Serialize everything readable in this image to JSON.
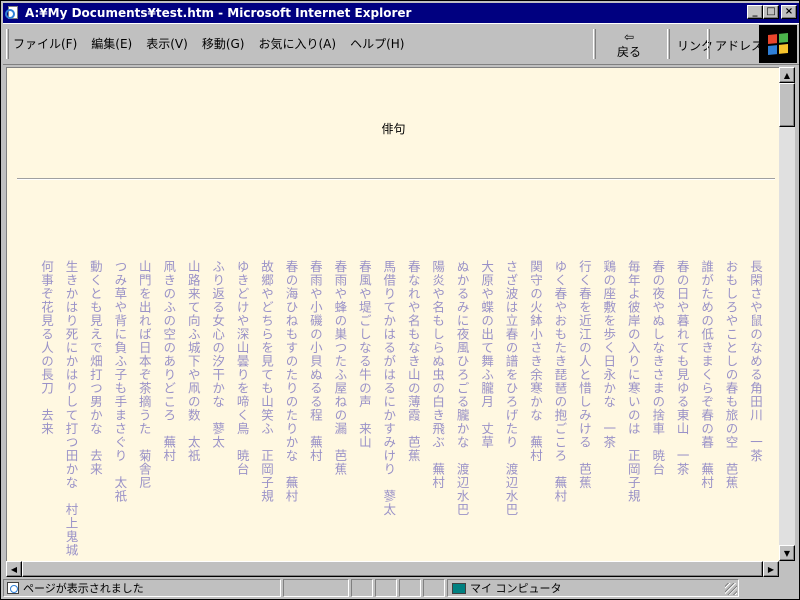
{
  "window": {
    "title": "A:¥My Documents¥test.htm - Microsoft Internet Explorer",
    "minimize_glyph": "_",
    "maximize_glyph": "□",
    "close_glyph": "×"
  },
  "menubar": {
    "items": [
      "ファイル(F)",
      "編集(E)",
      "表示(V)",
      "移動(G)",
      "お気に入り(A)",
      "ヘルプ(H)"
    ]
  },
  "toolbar": {
    "back_arrow": "⇦",
    "back_label": "戻る",
    "links_label": "リンク",
    "address_label": "アドレス"
  },
  "page": {
    "heading": "俳句",
    "haiku": [
      "長閑さや鼠のなめる角田川　一茶",
      "おもしろやことしの春も旅の空　芭蕉",
      "誰がための低きまくらぞ春の暮　蕪村",
      "春の日や暮れても見ゆる東山　一茶",
      "春の夜やぬしなきさまの捨車　暁台",
      "毎年よ彼岸の入りに寒いのは　正岡子規",
      "鶏の座敷を歩く日永かな　一茶",
      "行く春を近江の人と惜しみける　芭蕉",
      "ゆく春やおもたき琵琶の抱ごころ　蕪村",
      "関守の火鉢小さき余寒かな　蕪村",
      "さざ波は立春の譜をひろげたり　渡辺水巴",
      "大原や蝶の出て舞ふ朧月　丈草",
      "ぬかるみに夜風ひろごる朧かな　渡辺水巴",
      "陽炎や名もしらぬ虫の白き飛ぶ　蕪村",
      "春なれや名もなき山の薄霞　芭蕉",
      "馬借りてかはるがはるにかすみけり　蓼太",
      "春風や堤ごしなる牛の声　来山",
      "春雨や蜂の巣つたふ屋ねの漏　芭蕉",
      "春雨や小磯の小貝ぬるる程　蕪村",
      "春の海ひねもすのたりのたりかな　蕪村",
      "故郷やどちらを見ても山笑ふ　正岡子規",
      "ゆきどけや深山曇りを啼く鳥　暁台",
      "ふり返る女心の汐干かな　蓼太",
      "山路来て向ふ城下や凧の数　太祇",
      "凧きのふの空のありどころ　蕪村",
      "山門を出れば日本ぞ茶摘うた　菊舎尼",
      "つみ草や背に負ふ子も手まさぐり　太祇",
      "動くとも見えで畑打つ男かな　去来",
      "生きかはり死にかはりして打つ田かな　村上鬼城",
      "何事ぞ花見る人の長刀　去来"
    ]
  },
  "statusbar": {
    "message": "ページが表示されました",
    "zone": "マイ コンピュータ"
  },
  "colors": {
    "titlebar": "#000080",
    "page_background": "#fff8e1",
    "poem_text": "#9a92c8"
  }
}
